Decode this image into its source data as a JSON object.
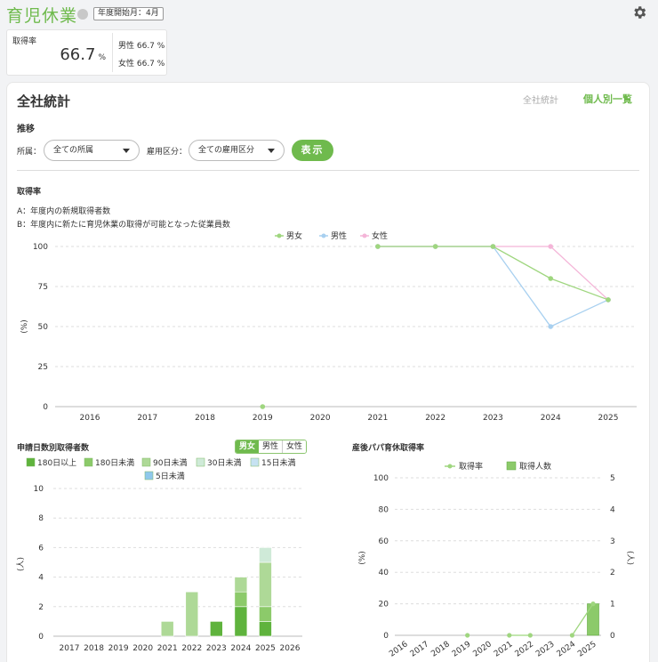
{
  "header": {
    "title": "育児休業",
    "fiscal_badge": "年度開始月：4月"
  },
  "summary": {
    "label": "取得率",
    "value": "66.7",
    "unit": "%",
    "male": "男性 66.7 %",
    "female": "女性 66.7 %"
  },
  "panel": {
    "title": "全社統計",
    "tab_all": "全社統計",
    "tab_individual": "個人別一覧",
    "section_title": "推移"
  },
  "filters": {
    "dept_label": "所属：",
    "dept_value": "全ての所属",
    "emp_label": "雇用区分：",
    "emp_value": "全ての雇用区分",
    "show_button": "表示"
  },
  "rate_section": {
    "title": "取得率",
    "note_a": "A：年度内の新規取得者数",
    "note_b": "B：年度内に新たに育児休業の取得が可能となった従業員数"
  },
  "colors": {
    "accent": "#6fba4d",
    "all": "#9fd67f",
    "male": "#a8d0f0",
    "female": "#f4b5d8"
  },
  "chart_data": [
    {
      "type": "line",
      "title": "取得率",
      "ylabel": "(%)",
      "x": [
        "2016",
        "2017",
        "2018",
        "2019",
        "2020",
        "2021",
        "2022",
        "2023",
        "2024",
        "2025"
      ],
      "yticks": [
        "0",
        "25",
        "50",
        "75",
        "100"
      ],
      "ylim": [
        0,
        100
      ],
      "legend": "top-center",
      "grid": true,
      "series": [
        {
          "name": "男女",
          "values": [
            null,
            null,
            null,
            0,
            null,
            100,
            100,
            100,
            80,
            66.7
          ]
        },
        {
          "name": "男性",
          "values": [
            null,
            null,
            null,
            null,
            null,
            100,
            100,
            100,
            50,
            66.7
          ]
        },
        {
          "name": "女性",
          "values": [
            null,
            null,
            null,
            null,
            null,
            100,
            100,
            100,
            100,
            66.7
          ]
        }
      ]
    },
    {
      "type": "bar",
      "title": "申請日数別取得者数",
      "ylabel": "(人)",
      "categories": [
        "2017",
        "2018",
        "2019",
        "2020",
        "2021",
        "2022",
        "2023",
        "2024",
        "2025",
        "2026"
      ],
      "yticks": [
        "0",
        "2",
        "4",
        "6",
        "8",
        "10"
      ],
      "ylim": [
        0,
        10
      ],
      "legend": "top",
      "toggle": [
        "男女",
        "男性",
        "女性"
      ],
      "series": [
        {
          "name": "180日以上",
          "values": [
            0,
            0,
            0,
            0,
            0,
            0,
            1,
            2,
            1,
            0
          ]
        },
        {
          "name": "180日未満",
          "values": [
            0,
            0,
            0,
            0,
            0,
            0,
            0,
            1,
            1,
            0
          ]
        },
        {
          "name": "90日未満",
          "values": [
            0,
            0,
            0,
            0,
            1,
            3,
            0,
            1,
            3,
            0
          ]
        },
        {
          "name": "30日未満",
          "values": [
            0,
            0,
            0,
            0,
            0,
            0,
            0,
            0,
            1,
            0
          ]
        },
        {
          "name": "15日未満",
          "values": [
            0,
            0,
            0,
            0,
            0,
            0,
            0,
            0,
            0,
            0
          ]
        },
        {
          "name": "5日未満",
          "values": [
            0,
            0,
            0,
            0,
            0,
            0,
            0,
            0,
            0,
            0
          ]
        }
      ]
    },
    {
      "type": "bar",
      "title": "産後パパ育休取得率",
      "ylabel": "(%)",
      "y2label": "(人)",
      "categories": [
        "2016",
        "2017",
        "2018",
        "2019",
        "2020",
        "2021",
        "2022",
        "2023",
        "2024",
        "2025"
      ],
      "yticks": [
        "0",
        "20",
        "40",
        "60",
        "80",
        "100"
      ],
      "y2ticks": [
        "0",
        "1",
        "2",
        "3",
        "4",
        "5"
      ],
      "ylim": [
        0,
        100
      ],
      "y2lim": [
        0,
        5
      ],
      "legend": "top",
      "series": [
        {
          "name": "取得率",
          "type": "line",
          "values": [
            null,
            null,
            null,
            0,
            null,
            0,
            0,
            null,
            0,
            20
          ]
        },
        {
          "name": "取得人数",
          "type": "bar",
          "values": [
            0,
            0,
            0,
            0,
            0,
            0,
            0,
            0,
            0,
            1
          ]
        }
      ]
    }
  ]
}
